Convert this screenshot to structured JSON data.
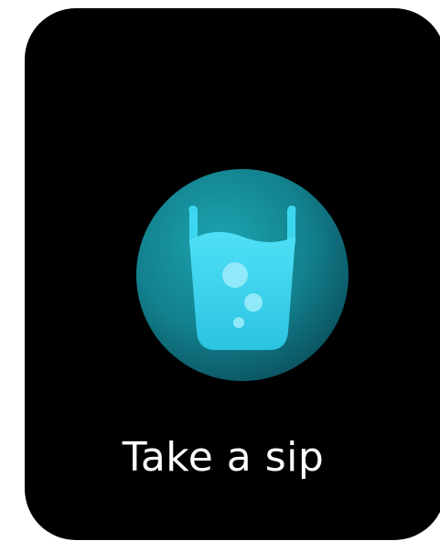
{
  "reminder": {
    "message": "Take a sip",
    "icon": "water-glass-icon"
  },
  "colors": {
    "background": "#000000",
    "circle_light": "#1a9aa6",
    "circle_dark": "#0d5f6b",
    "glass": "#39d3ee",
    "bubble": "#8ae8f8",
    "text": "#ffffff"
  }
}
